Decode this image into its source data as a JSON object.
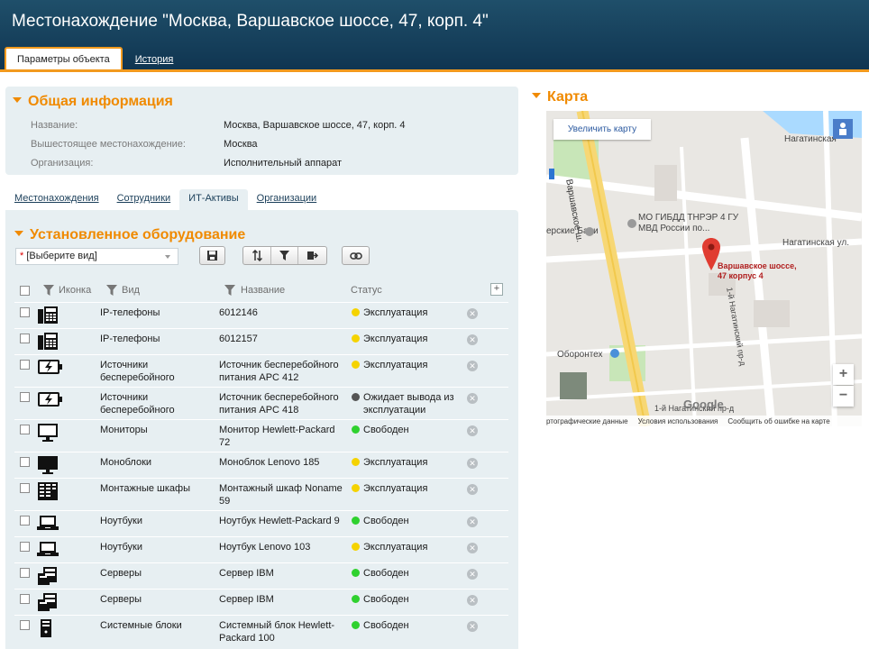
{
  "header": {
    "title": "Местонахождение \"Москва, Варшавское шоссе, 47, корп. 4\""
  },
  "top_tabs": [
    {
      "label": "Параметры объекта",
      "active": true
    },
    {
      "label": "История",
      "active": false
    }
  ],
  "general": {
    "title": "Общая информация",
    "fields": [
      {
        "label": "Название:",
        "value": "Москва, Варшавское шоссе, 47, корп. 4"
      },
      {
        "label": "Вышестоящее местонахождение:",
        "value": "Москва"
      },
      {
        "label": "Организация:",
        "value": "Исполнительный аппарат"
      }
    ]
  },
  "sub_tabs": [
    {
      "label": "Местонахождения",
      "active": false
    },
    {
      "label": "Сотрудники",
      "active": false
    },
    {
      "label": "ИТ-Активы",
      "active": true
    },
    {
      "label": "Организации",
      "active": false
    }
  ],
  "equipment": {
    "title": "Установленное оборудование",
    "view_select": {
      "required_mark": "*",
      "value": "[Выберите вид]"
    },
    "columns": {
      "icon": "Иконка",
      "type": "Вид",
      "name": "Название",
      "status": "Статус",
      "add": "+"
    },
    "rows": [
      {
        "icon": "ip-phone-icon",
        "type": "IP-телефоны",
        "name": "6012146",
        "status": "Эксплуатация",
        "status_color": "#f5d300"
      },
      {
        "icon": "ip-phone-icon",
        "type": "IP-телефоны",
        "name": "6012157",
        "status": "Эксплуатация",
        "status_color": "#f5d300"
      },
      {
        "icon": "ups-icon",
        "type": "Источники бесперебойного",
        "name": "Источник бесперебойного питания APC 412",
        "status": "Эксплуатация",
        "status_color": "#f5d300"
      },
      {
        "icon": "ups-icon",
        "type": "Источники бесперебойного",
        "name": "Источник бесперебойного питания APC 418",
        "status": "Ожидает вывода из эксплуатации",
        "status_color": "#555555"
      },
      {
        "icon": "monitor-icon",
        "type": "Мониторы",
        "name": "Монитор Hewlett-Packard 72",
        "status": "Свободен",
        "status_color": "#2fd12f"
      },
      {
        "icon": "monoblock-icon",
        "type": "Моноблоки",
        "name": "Моноблок Lenovo 185",
        "status": "Эксплуатация",
        "status_color": "#f5d300"
      },
      {
        "icon": "rack-icon",
        "type": "Монтажные шкафы",
        "name": "Монтажный шкаф Noname 59",
        "status": "Эксплуатация",
        "status_color": "#f5d300"
      },
      {
        "icon": "laptop-icon",
        "type": "Ноутбуки",
        "name": "Ноутбук Hewlett-Packard 9",
        "status": "Свободен",
        "status_color": "#2fd12f"
      },
      {
        "icon": "laptop-icon",
        "type": "Ноутбуки",
        "name": "Ноутбук Lenovo 103",
        "status": "Эксплуатация",
        "status_color": "#f5d300"
      },
      {
        "icon": "server-icon",
        "type": "Серверы",
        "name": "Сервер IBM",
        "status": "Свободен",
        "status_color": "#2fd12f"
      },
      {
        "icon": "server-icon",
        "type": "Серверы",
        "name": "Сервер IBM",
        "status": "Свободен",
        "status_color": "#2fd12f"
      },
      {
        "icon": "system-unit-icon",
        "type": "Системные блоки",
        "name": "Системный блок Hewlett-Packard 100",
        "status": "Свободен",
        "status_color": "#2fd12f"
      }
    ]
  },
  "map": {
    "title": "Карта",
    "enlarge_label": "Увеличить карту",
    "marker_label": "Варшавское шоссе, 47 корпус 4",
    "labels": {
      "street_varshavskoe": "Варшавское ш.",
      "gibdd": "МО ГИБДД ТНРЭР 4 ГУ МВД России по...",
      "bani": "ерские Бани",
      "nagatinskaya1": "Нагатинская",
      "nagatinskaya2": "Нагатинская ул.",
      "oboronteh": "Оборонтех",
      "nagatinsky_pr": "1-й Нагатинский пр-д",
      "nagatinsky_pr2": "1-й Нагатинский пр-д",
      "google": "Google"
    },
    "footer": [
      "ртографические данные",
      "Условия использования",
      "Сообщить об ошибке на карте"
    ],
    "zoom_in": "+",
    "zoom_out": "−"
  }
}
